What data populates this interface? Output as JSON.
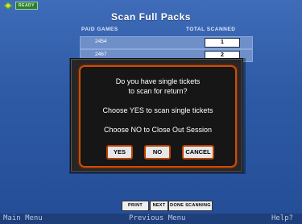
{
  "status": {
    "ready_label": "READY"
  },
  "header": {
    "title": "Scan Full Packs"
  },
  "table": {
    "columns": [
      "PAID GAMES",
      "TOTAL SCANNED"
    ],
    "rows": [
      {
        "game": "2454",
        "scanned": "1"
      },
      {
        "game": "2467",
        "scanned": "2"
      }
    ]
  },
  "dialog": {
    "line1": "Do you have single tickets",
    "line2": "to scan for return?",
    "line3": "Choose YES to scan single tickets",
    "line4": "Choose NO to Close Out Session",
    "yes_label": "YES",
    "no_label": "NO",
    "cancel_label": "CANCEL"
  },
  "actions": {
    "print_label": "PRINT",
    "next_label": "NEXT",
    "done_label": "DONE SCANNING"
  },
  "footer": {
    "main_menu": "Main Menu",
    "previous_menu": "Previous Menu",
    "help": "Help?"
  },
  "colors": {
    "background": "#2e5aa6",
    "dialog_border": "#d24a00",
    "ready_badge": "#2e7d32"
  }
}
